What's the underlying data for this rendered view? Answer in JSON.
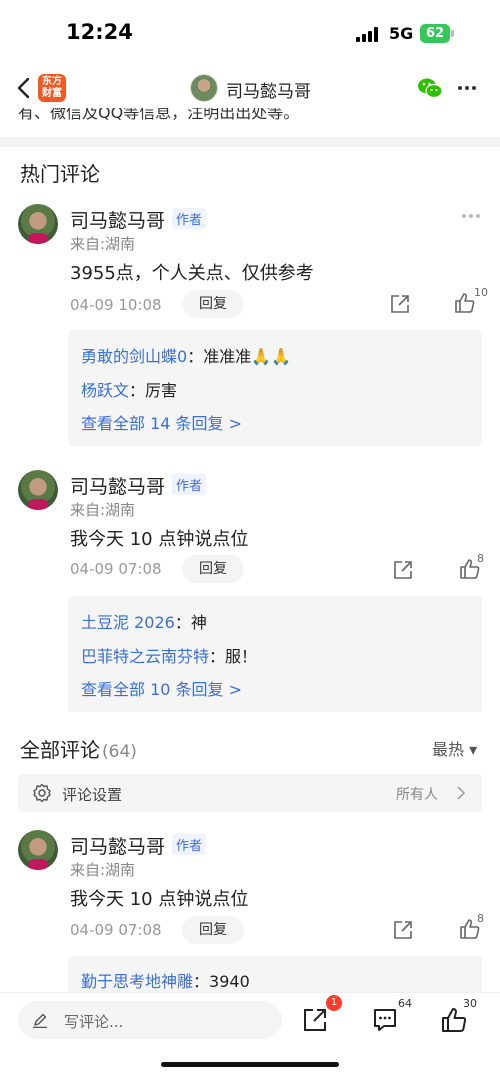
{
  "status": {
    "time": "12:24",
    "network": "5G",
    "battery": "62"
  },
  "nav": {
    "logo_line1": "东方",
    "logo_line2": "财富",
    "title": "司马懿马哥"
  },
  "clipped_text": "有、微信及QQ等信息，注明出出处等。",
  "hot_comments": {
    "title": "热门评论",
    "items": [
      {
        "name": "司马懿马哥",
        "tag": "作者",
        "location": "来自:湖南",
        "text": "3955点，个人关点、仅供参考",
        "time": "04-09 10:08",
        "reply_label": "回复",
        "likes": "10",
        "replies": [
          {
            "user": "勇敢的剑山蝶0",
            "sep": "：",
            "text": "准准准🙏🙏"
          },
          {
            "user": "杨跃文",
            "sep": "：",
            "text": "厉害"
          }
        ],
        "view_all": "查看全部 14 条回复 >"
      },
      {
        "name": "司马懿马哥",
        "tag": "作者",
        "location": "来自:湖南",
        "text": "我今天 10 点钟说点位",
        "time": "04-09 07:08",
        "reply_label": "回复",
        "likes": "8",
        "replies": [
          {
            "user": "土豆泥 2026",
            "sep": "：",
            "text": "神"
          },
          {
            "user": "巴菲特之云南芬特",
            "sep": "：",
            "text": "服！"
          }
        ],
        "view_all": "查看全部 10 条回复 >"
      }
    ]
  },
  "all_comments": {
    "title": "全部评论",
    "count": "(64)",
    "sort": "最热 ▾",
    "settings_label": "评论设置",
    "settings_value": "所有人",
    "items": [
      {
        "name": "司马懿马哥",
        "tag": "作者",
        "location": "来自:湖南",
        "text": "我今天 10 点钟说点位",
        "time": "04-09 07:08",
        "reply_label": "回复",
        "likes": "8",
        "replies": [
          {
            "user": "勤于思考地神雕",
            "sep": "：",
            "text": "3940"
          }
        ]
      }
    ]
  },
  "bottom": {
    "placeholder": "写评论...",
    "share_badge": "1",
    "comment_count": "64",
    "like_count": "30"
  }
}
